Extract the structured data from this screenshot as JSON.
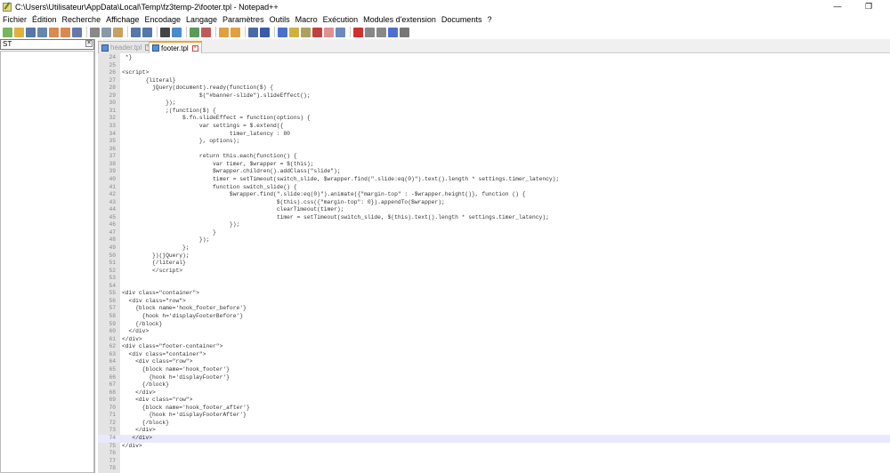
{
  "window": {
    "title": "C:\\Users\\Utilisateur\\AppData\\Local\\Temp\\fz3temp-2\\footer.tpl - Notepad++",
    "minimize": "—",
    "maximize": "❐"
  },
  "menu": [
    "Fichier",
    "Édition",
    "Recherche",
    "Affichage",
    "Encodage",
    "Langage",
    "Paramètres",
    "Outils",
    "Macro",
    "Exécution",
    "Modules d'extension",
    "Documents",
    "?"
  ],
  "toolbar": {
    "icons": [
      "new-file",
      "open-file",
      "save",
      "save-all",
      "close",
      "close-all",
      "print",
      "cut",
      "copy",
      "paste",
      "undo",
      "redo",
      "find",
      "replace",
      "zoom-in",
      "zoom-out",
      "sync-vertical",
      "sync-horizontal",
      "word-wrap",
      "show-all-chars",
      "indent-guide",
      "lang-define",
      "doc-map",
      "function-list",
      "folder-workspace",
      "monitor",
      "record-macro",
      "stop-record",
      "play-macro",
      "run-macro-multiple",
      "save-macro"
    ]
  },
  "left_panel": {
    "input_value": "ST",
    "close": "×"
  },
  "tabs": [
    {
      "label": "header.tpl",
      "active": false
    },
    {
      "label": "footer.tpl",
      "active": true
    }
  ],
  "editor": {
    "current_line": 74,
    "lines": [
      {
        "n": "24",
        "t": " *}"
      },
      {
        "n": "25",
        "t": ""
      },
      {
        "n": "26",
        "t": "<script>"
      },
      {
        "n": "27",
        "t": "       {literal}"
      },
      {
        "n": "28",
        "t": "         jQuery(document).ready(function($) {"
      },
      {
        "n": "29",
        "t": "                       $(\"#banner-slide\").slideEffect();"
      },
      {
        "n": "30",
        "t": "             });"
      },
      {
        "n": "31",
        "t": "             ;(function($) {"
      },
      {
        "n": "32",
        "t": "                  $.fn.slideEffect = function(options) {"
      },
      {
        "n": "33",
        "t": "                       var settings = $.extend({"
      },
      {
        "n": "34",
        "t": "                                timer_latency : 80"
      },
      {
        "n": "35",
        "t": "                       }, options);"
      },
      {
        "n": "36",
        "t": ""
      },
      {
        "n": "37",
        "t": "                       return this.each(function() {"
      },
      {
        "n": "38",
        "t": "                           var timer, $wrapper = $(this);"
      },
      {
        "n": "39",
        "t": "                           $wrapper.children().addClass(\"slide\");"
      },
      {
        "n": "40",
        "t": "                           timer = setTimeout(switch_slide, $wrapper.find(\".slide:eq(0)\").text().length * settings.timer_latency);"
      },
      {
        "n": "41",
        "t": "                           function switch_slide() {"
      },
      {
        "n": "42",
        "t": "                                $wrapper.find(\".slide:eq(0)\").animate({\"margin-top\" : -$wrapper.height()}, function () {"
      },
      {
        "n": "43",
        "t": "                                              $(this).css({\"margin-top\": 0}).appendTo($wrapper);"
      },
      {
        "n": "44",
        "t": "                                              clearTimeout(timer);"
      },
      {
        "n": "45",
        "t": "                                              timer = setTimeout(switch_slide, $(this).text().length * settings.timer_latency);"
      },
      {
        "n": "46",
        "t": "                                });"
      },
      {
        "n": "47",
        "t": "                           }"
      },
      {
        "n": "48",
        "t": "                       });"
      },
      {
        "n": "49",
        "t": "                  };"
      },
      {
        "n": "50",
        "t": "         })(jQuery);"
      },
      {
        "n": "51",
        "t": "         {/literal}"
      },
      {
        "n": "52",
        "t": "         </script>"
      },
      {
        "n": "53",
        "t": ""
      },
      {
        "n": "54",
        "t": ""
      },
      {
        "n": "55",
        "t": "<div class=\"container\">"
      },
      {
        "n": "56",
        "t": "  <div class=\"row\">"
      },
      {
        "n": "57",
        "t": "    {block name='hook_footer_before'}"
      },
      {
        "n": "58",
        "t": "      {hook h='displayFooterBefore'}"
      },
      {
        "n": "59",
        "t": "    {/block}"
      },
      {
        "n": "60",
        "t": "  </div>"
      },
      {
        "n": "61",
        "t": "</div>"
      },
      {
        "n": "62",
        "t": "<div class=\"footer-container\">"
      },
      {
        "n": "63",
        "t": "  <div class=\"container\">"
      },
      {
        "n": "64",
        "t": "    <div class=\"row\">"
      },
      {
        "n": "65",
        "t": "      {block name='hook_footer'}"
      },
      {
        "n": "66",
        "t": "        {hook h='displayFooter'}"
      },
      {
        "n": "67",
        "t": "      {/block}"
      },
      {
        "n": "68",
        "t": "    </div>"
      },
      {
        "n": "69",
        "t": "    <div class=\"row\">"
      },
      {
        "n": "70",
        "t": "      {block name='hook_footer_after'}"
      },
      {
        "n": "71",
        "t": "        {hook h='displayFooterAfter'}"
      },
      {
        "n": "72",
        "t": "      {/block}"
      },
      {
        "n": "73",
        "t": "    </div>"
      },
      {
        "n": "74",
        "t": "   </div>"
      },
      {
        "n": "75",
        "t": "</div>"
      },
      {
        "n": "76",
        "t": ""
      },
      {
        "n": "77",
        "t": ""
      },
      {
        "n": "78",
        "t": ""
      }
    ]
  },
  "colors": {
    "current_line": "#e8e8ff",
    "gutter": "#e4e4e4",
    "active_tab_accent": "#f0a030"
  }
}
